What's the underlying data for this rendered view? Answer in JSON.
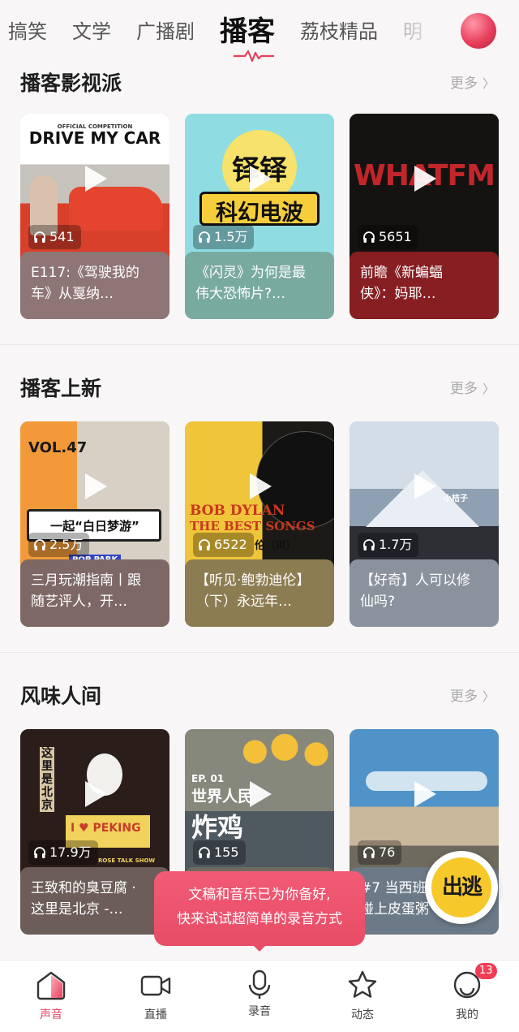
{
  "top_tabs": [
    {
      "label": "搞笑"
    },
    {
      "label": "文学"
    },
    {
      "label": "广播剧"
    },
    {
      "label": "播客"
    },
    {
      "label": "荔枝精品"
    },
    {
      "label": "明"
    }
  ],
  "sections": [
    {
      "title": "播客影视派",
      "more": "更多",
      "cards": [
        {
          "cover_title": "DRIVE MY CAR",
          "cover_small": "OFFICIAL COMPETITION",
          "count": "541",
          "line1": "E117:《驾驶我的",
          "line2": "车》从戛纳…",
          "bg": "#8e7576"
        },
        {
          "cover_title": "铎铎",
          "cover_sub": "科幻电波",
          "count": "1.5万",
          "line1": "《闪灵》为何是最",
          "line2": "伟大恐怖片?…",
          "bg": "#79aaa0"
        },
        {
          "cover_title": "WHATFM",
          "count": "5651",
          "line1": "前瞻《新蝙蝠",
          "line2": "侠》：妈耶…",
          "bg": "#861e22"
        }
      ]
    },
    {
      "title": "播客上新",
      "more": "更多",
      "cards": [
        {
          "cover_title": "VOL.47",
          "cover_sub": "一起“白日梦游”",
          "cover_small": "POP PARK",
          "count": "2.5万",
          "line1": "三月玩潮指南丨跟",
          "line2": "随艺评人，开…",
          "bg": "#7e6866"
        },
        {
          "cover_title": "BOB DYLAN",
          "cover_sub": "THE BEST SONGS",
          "cover_small": "伦（Ⅲ）",
          "count": "6522",
          "line1": "【听见·鲍勃迪伦】",
          "line2": "（下）永远年…",
          "bg": "#8c7c52"
        },
        {
          "cover_title": "小桔子",
          "count": "1.7万",
          "line1": "【好奇】人可以修",
          "line2": "仙吗?",
          "bg": "#8a929e"
        }
      ]
    },
    {
      "title": "风味人间",
      "more": "更多",
      "cards": [
        {
          "cover_title": "I ♥ PEKING",
          "cover_sub": "这里是北京",
          "cover_small": "ROSE TALK SHOW",
          "count": "17.9万",
          "line1": "王致和的臭豆腐 ·",
          "line2": "这里是北京 -…",
          "bg": "#6c5d58"
        },
        {
          "cover_title": "炸鸡",
          "cover_sub": "世界人民",
          "cover_small": "EP. 01",
          "count": "155",
          "line1": "",
          "line2": "",
          "bg": "#6f6a5e"
        },
        {
          "cover_title": "",
          "count": "76",
          "line1": "#7 当西班",
          "line2": "碰上皮蛋粥",
          "bg": "#6c7a88"
        }
      ]
    }
  ],
  "toast": {
    "line1": "文稿和音乐已为你备好,",
    "line2": "快来试试超简单的录音方式"
  },
  "float_button": {
    "label": "出逃"
  },
  "bottom_nav": [
    {
      "label": "声音",
      "icon": "home-icon",
      "active": true
    },
    {
      "label": "直播",
      "icon": "video-camera-icon"
    },
    {
      "label": "录音",
      "icon": "microphone-icon"
    },
    {
      "label": "动态",
      "icon": "star-icon"
    },
    {
      "label": "我的",
      "icon": "profile-icon",
      "badge": "13"
    }
  ],
  "colors": {
    "accent": "#e8405c",
    "toast": "#ee5670",
    "more_text": "#aaaaaa"
  }
}
